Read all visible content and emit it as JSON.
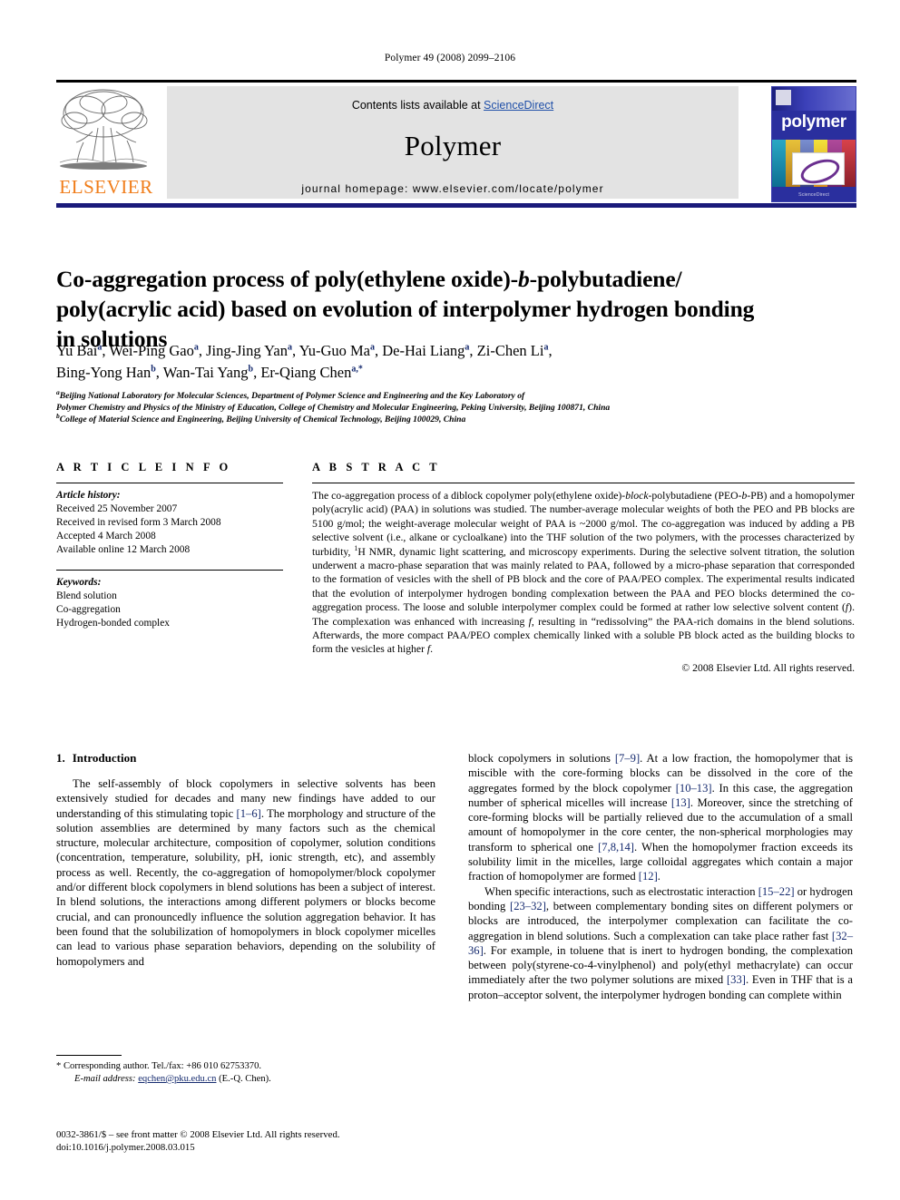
{
  "running_head": "Polymer 49 (2008) 2099–2106",
  "masthead": {
    "contents_prefix": "Contents lists available at ",
    "contents_link": "ScienceDirect",
    "journal_name": "Polymer",
    "homepage": "journal homepage: www.elsevier.com/locate/polymer",
    "publisher_wordmark": "ELSEVIER",
    "publisher_color": "#f07d1a",
    "link_color": "#1f4fa8",
    "cover": {
      "title": "polymer",
      "footer": "ScienceDirect",
      "background": "#2a2f9e"
    }
  },
  "article": {
    "title_line1_a": "Co-aggregation process of poly(ethylene oxide)-",
    "title_line1_b": "b",
    "title_line1_c": "-polybutadiene/",
    "title_line2": "poly(acrylic acid) based on evolution of interpolymer hydrogen",
    "title_line3": "bonding in solutions",
    "authors_line1": [
      {
        "name": "Yu Bai",
        "sup": "a"
      },
      {
        "name": "Wei-Ping Gao",
        "sup": "a"
      },
      {
        "name": "Jing-Jing Yan",
        "sup": "a"
      },
      {
        "name": "Yu-Guo Ma",
        "sup": "a"
      },
      {
        "name": "De-Hai Liang",
        "sup": "a"
      },
      {
        "name": "Zi-Chen Li",
        "sup": "a"
      }
    ],
    "authors_line2": [
      {
        "name": "Bing-Yong Han",
        "sup": "b"
      },
      {
        "name": "Wan-Tai Yang",
        "sup": "b"
      },
      {
        "name": "Er-Qiang Chen",
        "sup": "a,*"
      }
    ],
    "affiliation_a_line1": "Beijing National Laboratory for Molecular Sciences, Department of Polymer Science and Engineering and the Key Laboratory of",
    "affiliation_a_line2": "Polymer Chemistry and Physics of the Ministry of Education, College of Chemistry and Molecular Engineering, Peking University, Beijing 100871, China",
    "affiliation_b": "College of Material Science and Engineering, Beijing University of Chemical Technology, Beijing 100029, China",
    "affiliation_a_marker": "a",
    "affiliation_b_marker": "b"
  },
  "article_info": {
    "heading": "A R T I C L E  I N F O",
    "history_title": "Article history:",
    "history": [
      "Received 25 November 2007",
      "Received in revised form 3 March 2008",
      "Accepted 4 March 2008",
      "Available online 12 March 2008"
    ],
    "keywords_title": "Keywords:",
    "keywords": [
      "Blend solution",
      "Co-aggregation",
      "Hydrogen-bonded complex"
    ]
  },
  "abstract": {
    "heading": "A B S T R A C T",
    "part1": "The co-aggregation process of a diblock copolymer poly(ethylene oxide)-",
    "italic1": "block",
    "part2": "-polybutadiene (PEO-",
    "italic2": "b",
    "part3": "-PB) and a homopolymer poly(acrylic acid) (PAA) in solutions was studied. The number-average molecular weights of both the PEO and PB blocks are 5100 g/mol; the weight-average molecular weight of PAA is ~2000 g/mol. The co-aggregation was induced by adding a PB selective solvent (i.e., alkane or cycloalkane) into the THF solution of the two polymers, with the processes characterized by turbidity, ",
    "sup_h": "1",
    "part4": "H NMR, dynamic light scattering, and microscopy experiments. During the selective solvent titration, the solution underwent a macro-phase separation that was mainly related to PAA, followed by a micro-phase separation that corresponded to the formation of vesicles with the shell of PB block and the core of PAA/PEO complex. The experimental results indicated that the evolution of interpolymer hydrogen bonding complexation between the PAA and PEO blocks determined the co-aggregation process. The loose and soluble interpolymer complex could be formed at rather low selective solvent content (",
    "italic3": "f",
    "part5": "). The complexation was enhanced with increasing ",
    "italic4": "f",
    "part6": ", resulting in “redissolving” the PAA-rich domains in the blend solutions. Afterwards, the more compact PAA/PEO complex chemically linked with a soluble PB block acted as the building blocks to form the vesicles at higher ",
    "italic5": "f",
    "part7": ".",
    "copyright": "© 2008 Elsevier Ltd. All rights reserved."
  },
  "introduction": {
    "number": "1.",
    "heading": "Introduction",
    "left_paragraph": "The self-assembly of block copolymers in selective solvents has been extensively studied for decades and many new findings have added to our understanding of this stimulating topic [1–6]. The morphology and structure of the solution assemblies are determined by many factors such as the chemical structure, molecular architecture, composition of copolymer, solution conditions (concentration, temperature, solubility, pH, ionic strength, etc), and assembly process as well. Recently, the co-aggregation of homopolymer/block copolymer and/or different block copolymers in blend solutions has been a subject of interest. In blend solutions, the interactions among different polymers or blocks become crucial, and can pronouncedly influence the solution aggregation behavior. It has been found that the solubilization of homopolymers in block copolymer micelles can lead to various phase separation behaviors, depending on the solubility of homopolymers and",
    "right_paragraph_1": "block copolymers in solutions [7–9]. At a low fraction, the homopolymer that is miscible with the core-forming blocks can be dissolved in the core of the aggregates formed by the block copolymer [10–13]. In this case, the aggregation number of spherical micelles will increase [13]. Moreover, since the stretching of core-forming blocks will be partially relieved due to the accumulation of a small amount of homopolymer in the core center, the non-spherical morphologies may transform to spherical one [7,8,14]. When the homopolymer fraction exceeds its solubility limit in the micelles, large colloidal aggregates which contain a major fraction of homopolymer are formed [12].",
    "right_paragraph_2": "When specific interactions, such as electrostatic interaction [15–22] or hydrogen bonding [23–32], between complementary bonding sites on different polymers or blocks are introduced, the interpolymer complexation can facilitate the co-aggregation in blend solutions. Such a complexation can take place rather fast [32–36]. For example, in toluene that is inert to hydrogen bonding, the complexation between poly(styrene-co-4-vinylphenol) and poly(ethyl methacrylate) can occur immediately after the two polymer solutions are mixed [33]. Even in THF that is a proton–acceptor solvent, the interpolymer hydrogen bonding can complete within",
    "reference_color": "#152a6e"
  },
  "footnote": {
    "corresponding_marker": "*",
    "corresponding_text": "Corresponding author. Tel./fax: +86 010 62753370.",
    "email_label": "E-mail address:",
    "email": "eqchen@pku.edu.cn",
    "email_suffix": "(E.-Q. Chen)."
  },
  "imprint": {
    "line1": "0032-3861/$ – see front matter © 2008 Elsevier Ltd. All rights reserved.",
    "line2": "doi:10.1016/j.polymer.2008.03.015"
  }
}
